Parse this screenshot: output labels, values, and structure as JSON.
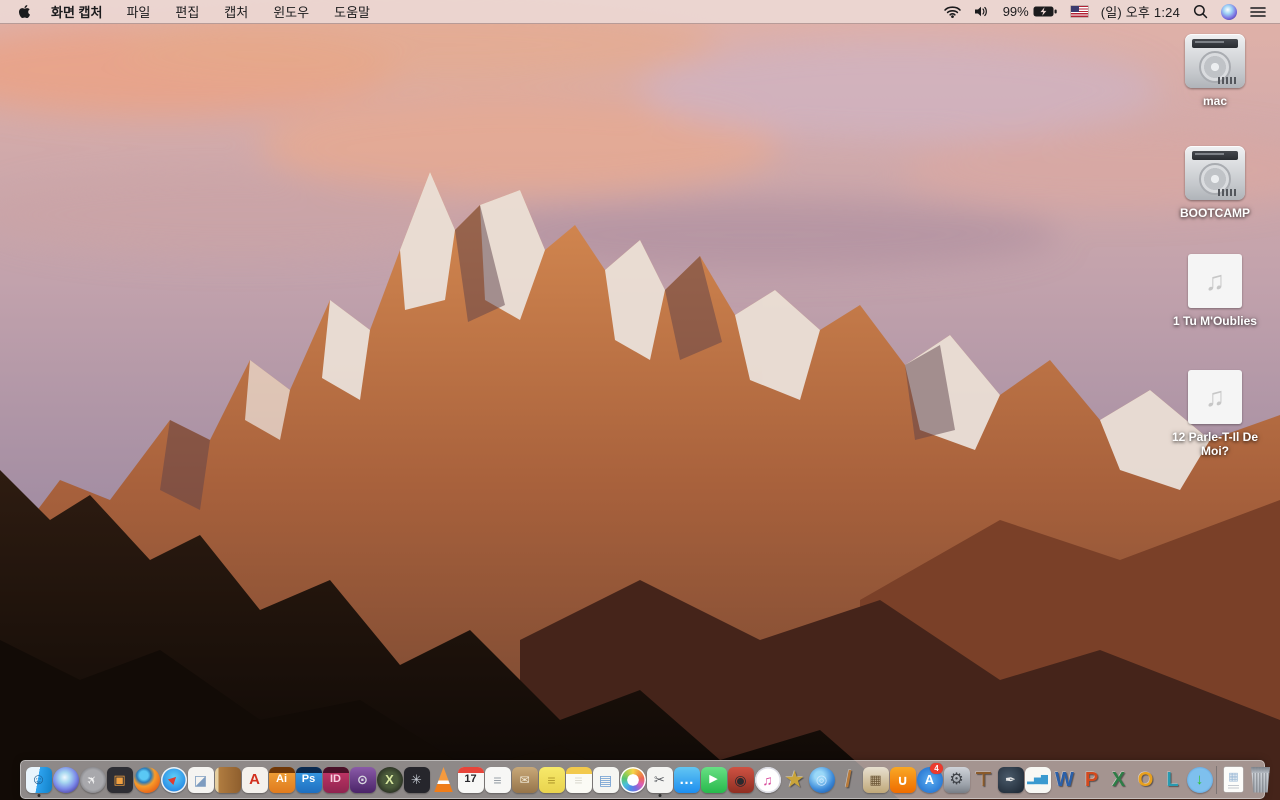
{
  "menubar": {
    "app_name": "화면 캡처",
    "menus": [
      "파일",
      "편집",
      "캡처",
      "윈도우",
      "도움말"
    ],
    "status": {
      "battery_percent": "99%",
      "clock": "(일) 오후 1:24",
      "icons": [
        "wifi-icon",
        "volume-icon",
        "battery-charging-icon",
        "us-flag-icon",
        "spotlight-search-icon",
        "siri-icon",
        "notification-center-icon"
      ]
    }
  },
  "desktop": {
    "wallpaper": "macos-sierra-mountain-sunset",
    "icons": [
      {
        "name": "mac",
        "type": "disk",
        "label": "mac"
      },
      {
        "name": "bootcamp",
        "type": "disk",
        "label": "BOOTCAMP"
      },
      {
        "name": "audio-tu-moublies",
        "type": "audio",
        "label": "1 Tu M'Oublies"
      },
      {
        "name": "audio-parle-t-il-de-moi",
        "type": "audio",
        "label": "12 Parle-T-Il De Moi?"
      }
    ]
  },
  "dock": {
    "items": [
      {
        "name": "finder",
        "shape": "rounded",
        "bg": "linear-gradient(100deg,#e9f5fd 0%,#e9f5fd 46%,#2ea3ef 46%,#1181c8 100%)",
        "glyph": "☺",
        "fg": "#1c5d92",
        "size": 15,
        "running": true
      },
      {
        "name": "siri",
        "shape": "circle",
        "bg": "radial-gradient(circle at 45% 40%,#f0f8ff 0%,#a8d8f0 25%,#7a88e8 55%,#4a3a9a 85%,#2a2060 100%)"
      },
      {
        "name": "launchpad",
        "shape": "circle",
        "bg": "radial-gradient(circle,#a8a8ac 0%,#a8a8ac 55%,#707074 85%,#58585c 100%)",
        "glyph": "✈",
        "fg": "#f2f2f2",
        "size": 12,
        "rot": -45
      },
      {
        "name": "mission-control",
        "shape": "rounded",
        "bg": "#2e2e34",
        "glyph": "▣",
        "fg": "#f0a040",
        "size": 13
      },
      {
        "name": "firefox",
        "shape": "circle",
        "bg": "radial-gradient(circle at 38% 32%,#5ac8f5 0%,#5ac8f5 18%,#2a7ab8 30%,#f89c2a 46%,#e8681a 75%,#d4500f 100%)"
      },
      {
        "name": "safari",
        "shape": "circle",
        "bg": "radial-gradient(circle at 50% 40%,#5fd0f8 0%,#1a7ae0 85%)",
        "ring": "#f0f0f0",
        "glyph": "▶",
        "fg": "#e03b30",
        "size": 10,
        "rot": -45
      },
      {
        "name": "preview",
        "shape": "rounded",
        "bg": "#f5f4f1",
        "glyph": "◪",
        "fg": "#7d9cc0",
        "size": 14
      },
      {
        "name": "contacts",
        "shape": "rounded",
        "bg": "linear-gradient(90deg,#e6cfa0 0%,#e6cfa0 14%,#b07c40 14%,#8f5f2e 100%)"
      },
      {
        "name": "acrobat",
        "shape": "rounded",
        "bg": "#f4f1ec",
        "glyph": "A",
        "fg": "#d2301e",
        "size": 15
      },
      {
        "name": "illustrator",
        "shape": "rounded",
        "bg": "linear-gradient(180deg,#f2a63c,#e07b1e)",
        "topBar": "#703808",
        "glyph": "Ai",
        "fg": "#ffffff",
        "size": 11
      },
      {
        "name": "photoshop",
        "shape": "rounded",
        "bg": "linear-gradient(180deg,#3ba0e8,#1f6fc0)",
        "topBar": "#0a2a50",
        "glyph": "Ps",
        "fg": "#ffffff",
        "size": 11
      },
      {
        "name": "indesign",
        "shape": "rounded",
        "bg": "linear-gradient(180deg,#c8386a,#8f2450)",
        "topBar": "#4a1028",
        "glyph": "ID",
        "fg": "#f8d0e0",
        "size": 11
      },
      {
        "name": "toast",
        "shape": "rounded",
        "bg": "linear-gradient(180deg,#8a5aa8,#4a2468)",
        "glyph": "⊙",
        "fg": "#d8d8e0",
        "size": 13
      },
      {
        "name": "x-utility",
        "shape": "circle",
        "bg": "radial-gradient(circle,#4a5a3a 0%,#4a5a3a 40%,#141414 100%)",
        "glyph": "X",
        "fg": "#d8e8a0",
        "size": 13
      },
      {
        "name": "disk-fan-utility",
        "shape": "rounded",
        "bg": "#26262c",
        "glyph": "✳",
        "fg": "#c8ced6",
        "size": 13
      },
      {
        "name": "vlc",
        "shape": "cone"
      },
      {
        "name": "calendar",
        "shape": "rounded",
        "bg": "#f8f8f6",
        "topBar": "#e8453a",
        "glyph": "17",
        "fg": "#28282c",
        "size": 11
      },
      {
        "name": "reminders",
        "shape": "rounded",
        "bg": "#f7f7f5",
        "glyph": "≡",
        "fg": "#98a0a8",
        "size": 14
      },
      {
        "name": "archive-box",
        "shape": "rounded",
        "bg": "linear-gradient(180deg,#c8a878,#96744a)",
        "glyph": "✉",
        "fg": "#f2ead8",
        "size": 12
      },
      {
        "name": "stickies",
        "shape": "rounded",
        "bg": "linear-gradient(180deg,#f7e96a,#e9d34e)",
        "glyph": "≡",
        "fg": "#b49c2e",
        "size": 14
      },
      {
        "name": "notes",
        "shape": "rounded",
        "bg": "linear-gradient(180deg,#f2c94c 0%,#f2c94c 26%,#fbfbf5 26%)",
        "glyph": "≡",
        "fg": "#dddcd2",
        "size": 14
      },
      {
        "name": "documents-app",
        "shape": "rounded",
        "bg": "#f6f6f2",
        "glyph": "▤",
        "fg": "#6a9ad0",
        "size": 14
      },
      {
        "name": "photos",
        "shape": "circle",
        "bg": "radial-gradient(circle,#ffffff 0%,#ffffff 31%,rgba(255,255,255,0) 32%),conic-gradient(#f6d44a,#f09a3e,#ec6657,#d95fb8,#7a6ce0,#4a90e8,#4ac2d8,#58c471,#aad04e,#f6d44a)",
        "ring": "#ffffff"
      },
      {
        "name": "grab-screen-capture",
        "shape": "rounded",
        "bg": "#f4f4f2",
        "glyph": "✂",
        "fg": "#55585e",
        "size": 13,
        "running": true
      },
      {
        "name": "messages",
        "shape": "rounded",
        "bg": "linear-gradient(180deg,#62c6f2,#1d8ef0)",
        "glyph": "…",
        "fg": "#ffffff",
        "size": 15
      },
      {
        "name": "facetime",
        "shape": "rounded",
        "bg": "linear-gradient(180deg,#67e084,#28b94c)",
        "glyph": "▶",
        "fg": "#ffffff",
        "size": 11
      },
      {
        "name": "photo-booth",
        "shape": "rounded",
        "bg": "linear-gradient(180deg,#cf5243,#8f2f22)",
        "glyph": "◉",
        "fg": "#2a2a2e",
        "size": 14
      },
      {
        "name": "itunes",
        "shape": "circle",
        "bg": "radial-gradient(circle,#ffffff 0%,#ffffff 60%,#eceef2 100%)",
        "ring": "#dcdce4",
        "glyph": "♫",
        "fg": "#d84a9a",
        "size": 14
      },
      {
        "name": "star-app",
        "shape": "plain",
        "glyph": "★",
        "fg": "#c9a43a",
        "size": 23
      },
      {
        "name": "dvd-ripper",
        "shape": "circle",
        "bg": "radial-gradient(circle at 40% 35%,#9ad8f8 0%,#9ad8f8 20%,#3a88d8 60%,#1a4a90 100%)",
        "glyph": "◎",
        "fg": "#cfe8ff",
        "size": 13
      },
      {
        "name": "garageband",
        "shape": "plain",
        "glyph": "/",
        "fg": "#b87a3a",
        "size": 23
      },
      {
        "name": "collage-app",
        "shape": "rounded",
        "bg": "linear-gradient(180deg,#e8e0d0,#c0a878)",
        "glyph": "▦",
        "fg": "#6a5434",
        "size": 13
      },
      {
        "name": "ibooks",
        "shape": "rounded",
        "bg": "linear-gradient(180deg,#f9a825,#ef6c00)",
        "glyph": "∪",
        "fg": "#ffffff",
        "size": 14
      },
      {
        "name": "app-store",
        "shape": "circle",
        "bg": "radial-gradient(circle,#5aaef2,#1a66c8)",
        "glyph": "A",
        "fg": "#ffffff",
        "size": 13,
        "badge": "4"
      },
      {
        "name": "system-preferences",
        "shape": "rounded",
        "bg": "linear-gradient(180deg,#cfd3d9 0%,#9aa0a8 70%,#787e86 100%)",
        "glyph": "⚙",
        "fg": "#3e4248",
        "size": 16
      },
      {
        "name": "keynote",
        "shape": "plain",
        "glyph": "⊤",
        "fg": "#8a5a2a",
        "size": 20
      },
      {
        "name": "pages",
        "shape": "rounded",
        "bg": "radial-gradient(circle at 40% 40%,#4a5a6a,#1a2430)",
        "glyph": "✒",
        "fg": "#e8e8e8",
        "size": 13
      },
      {
        "name": "numbers",
        "shape": "rounded",
        "bg": "#f8f8f4",
        "glyph": "▂▅▇",
        "fg": "#3a9ad0",
        "size": 9
      },
      {
        "name": "ms-word",
        "shape": "plain",
        "glyph": "W",
        "fg": "#2b5fa8",
        "size": 20
      },
      {
        "name": "ms-powerpoint",
        "shape": "plain",
        "glyph": "P",
        "fg": "#d2491e",
        "size": 20
      },
      {
        "name": "ms-excel",
        "shape": "plain",
        "glyph": "X",
        "fg": "#2e7d46",
        "size": 20
      },
      {
        "name": "ms-outlook",
        "shape": "plain",
        "glyph": "O",
        "fg": "#e8a01e",
        "size": 20
      },
      {
        "name": "ms-lync",
        "shape": "plain",
        "glyph": "L",
        "fg": "#2a9ab0",
        "size": 20
      },
      {
        "name": "web-downloader",
        "shape": "circle",
        "bg": "radial-gradient(circle,#7ec0ee 0%,#7ec0ee 60%,#3a78c0 100%)",
        "glyph": "↓",
        "fg": "#2ec22e",
        "size": 15
      },
      {
        "type": "separator",
        "name": "separator"
      },
      {
        "name": "document-file",
        "shape": "doc",
        "glyph": "▦",
        "fg": "#9ab8d6",
        "size": 11
      },
      {
        "name": "trash-full",
        "shape": "trash"
      }
    ]
  }
}
